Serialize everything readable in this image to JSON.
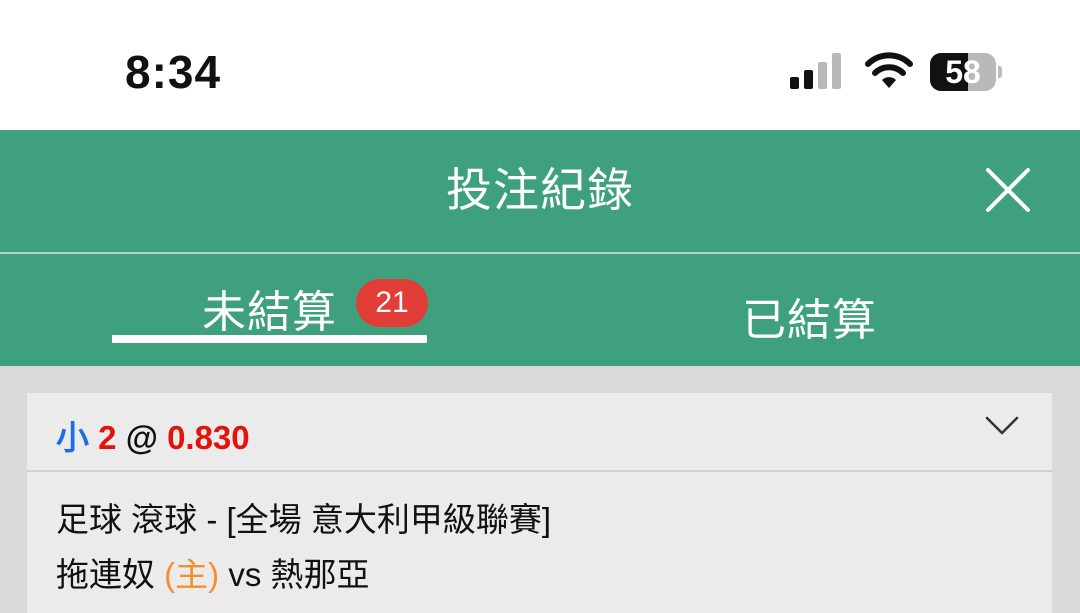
{
  "status_bar": {
    "time": "8:34",
    "battery_percent": "58",
    "battery_level": 0.58,
    "icons": [
      "signal-icon",
      "wifi-icon",
      "battery-icon"
    ]
  },
  "header": {
    "title": "投注紀錄",
    "close_icon": "close-icon"
  },
  "tabs": [
    {
      "label": "未結算",
      "badge": "21",
      "active": true
    },
    {
      "label": "已結算",
      "active": false
    }
  ],
  "bet": {
    "selection": "小",
    "line": "2",
    "at": "@",
    "odds": "0.830",
    "competition": "足球 滾球 - [全場 意大利甲級聯賽]",
    "home_team": "拖連奴",
    "home_tag": "(主)",
    "vs": "vs",
    "away_team": "熱那亞"
  },
  "colors": {
    "header_green": "#3fa07e",
    "badge_red": "#e23d36",
    "selection_blue": "#1c6ee8",
    "odds_red": "#e3120b",
    "home_tag_orange": "#f0922b",
    "card_bg": "#ebebeb",
    "page_bg": "#d9d9d9"
  }
}
